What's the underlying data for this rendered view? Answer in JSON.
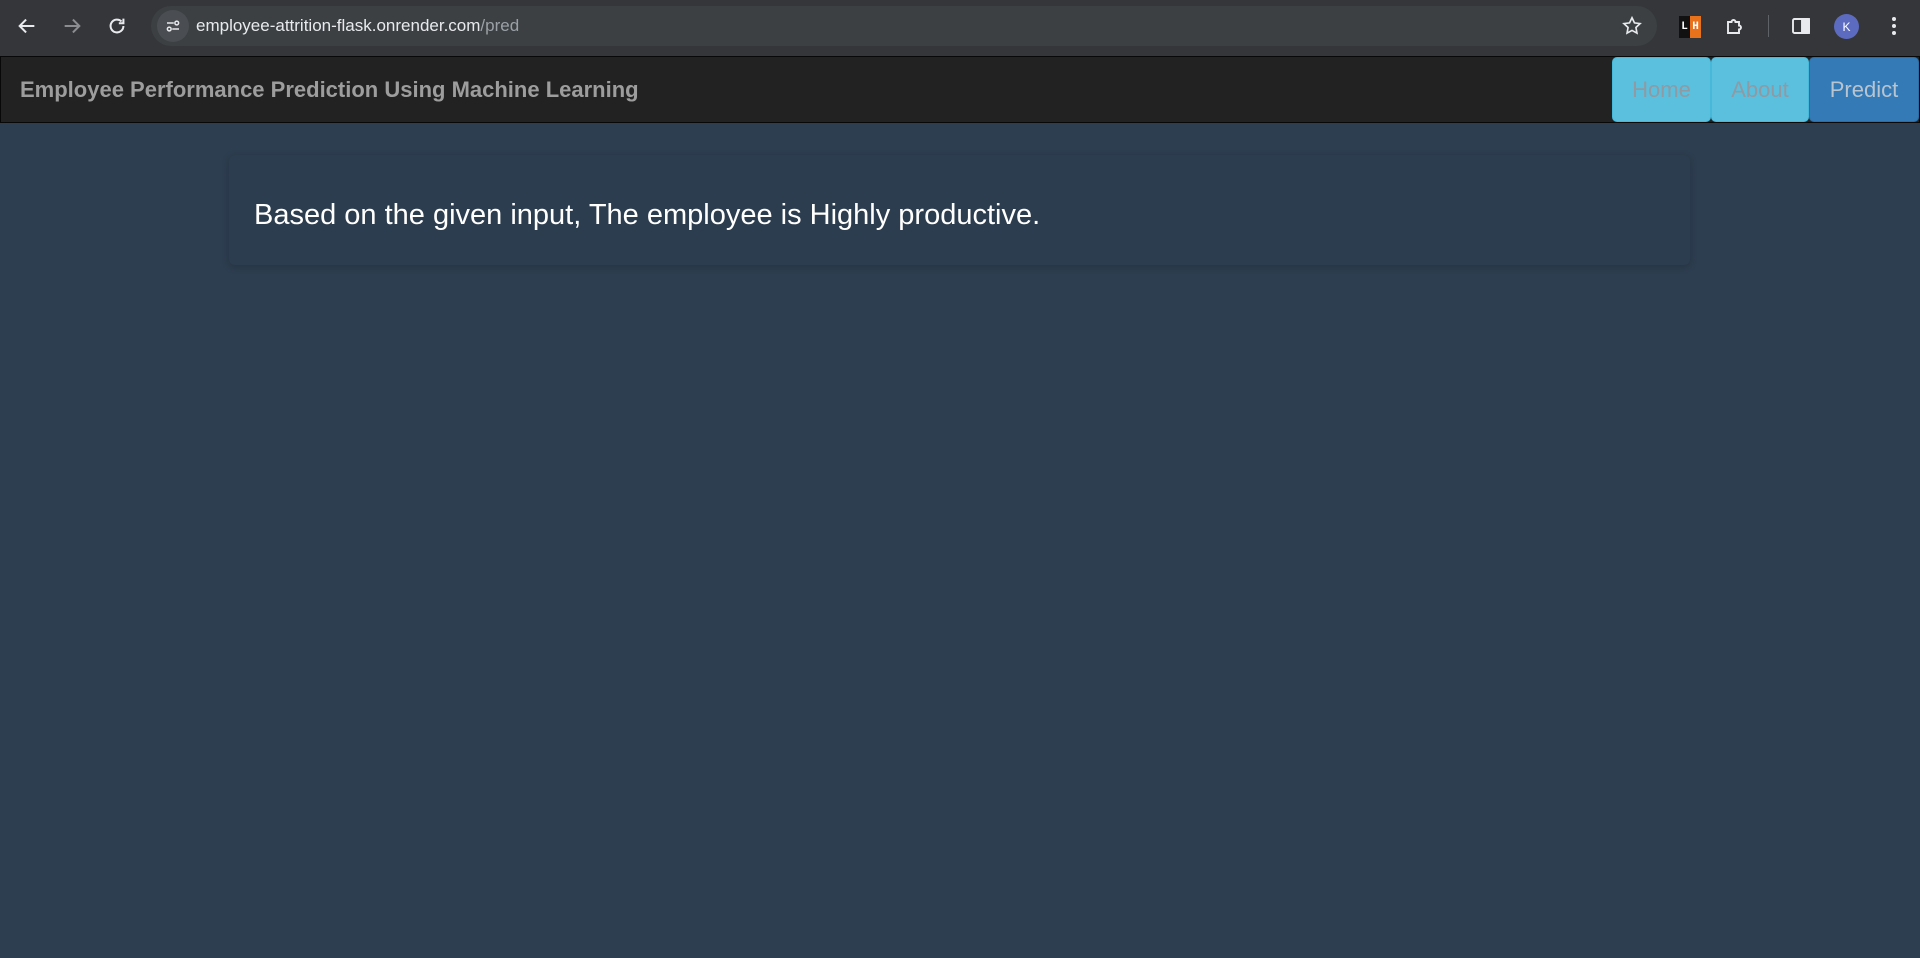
{
  "browser": {
    "url_host": "employee-attrition-flask.onrender.com",
    "url_path": "/pred",
    "extension_badge": [
      "L",
      "H"
    ],
    "profile_initial": "K",
    "icons": [
      "back-icon",
      "forward-icon",
      "reload-icon",
      "site-info-icon",
      "star-icon",
      "puzzle-icon",
      "side-panel-icon",
      "kebab-menu-icon"
    ]
  },
  "navbar": {
    "brand": "Employee Performance Prediction Using Machine Learning",
    "links": [
      {
        "label": "Home"
      },
      {
        "label": "About"
      },
      {
        "label": "Predict"
      }
    ]
  },
  "result": {
    "text": "Based on the given input, The employee is Highly productive."
  },
  "colors": {
    "page_background": "#2d3e50",
    "navbar_background": "#222222",
    "info_button": "#5bc0de",
    "primary_button": "#337ab7"
  }
}
